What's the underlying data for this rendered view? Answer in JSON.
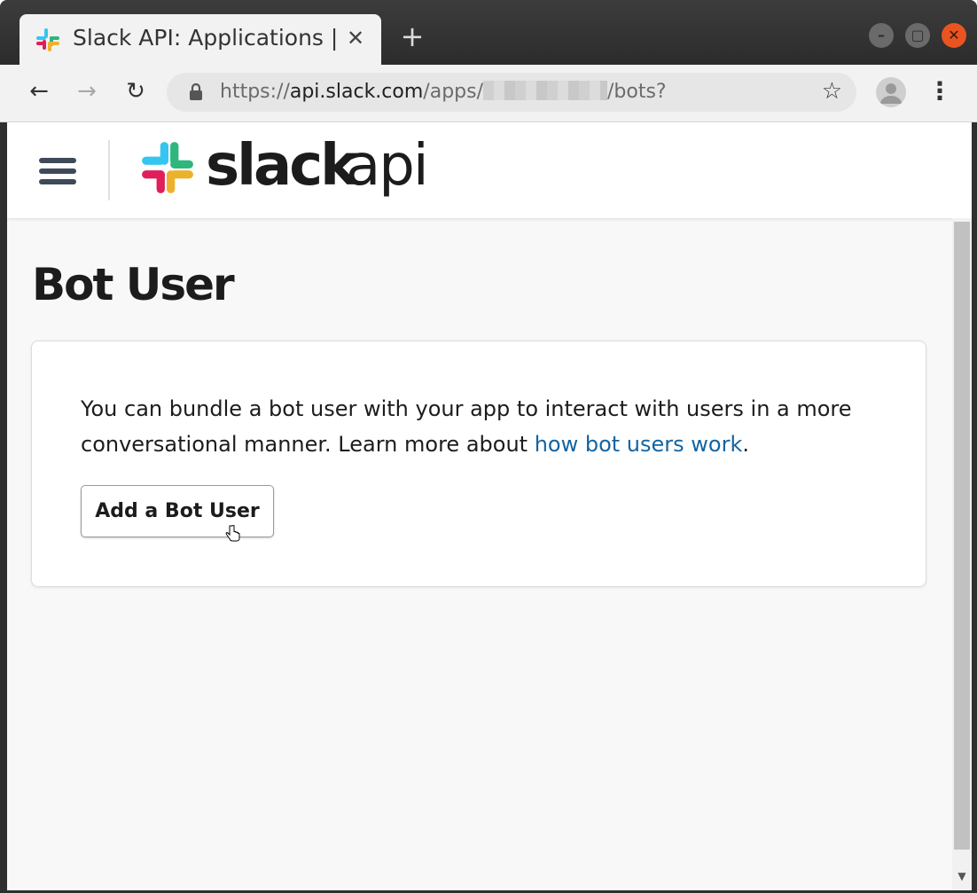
{
  "browser": {
    "tab_title": "Slack API: Applications |",
    "tab_close": "✕",
    "new_tab": "+",
    "window_controls": {
      "minimize": "–",
      "maximize": "▢",
      "close": "✕"
    },
    "nav": {
      "back": "←",
      "forward": "→",
      "reload": "↻"
    },
    "url": {
      "scheme": "https://",
      "host": "api.slack.com",
      "path_start": "/apps/",
      "path_end": "/bots?"
    },
    "bookmark_star": "☆",
    "menu": "⋮",
    "accent_close": "#e95420"
  },
  "header": {
    "brand_word": "slack",
    "brand_suffix": "api"
  },
  "page": {
    "title": "Bot User",
    "description_prefix": "You can bundle a bot user with your app to interact with users in a more conversational manner. Learn more about ",
    "link_text": "how bot users work",
    "description_suffix": ".",
    "add_button": "Add a Bot User",
    "link_color": "#1264a3"
  },
  "icons": {
    "tab_favicon": "slack-logo-icon",
    "lock": "lock-icon",
    "profile": "profile-icon",
    "menu": "hamburger-icon",
    "cursor": "hand-pointer-icon"
  }
}
